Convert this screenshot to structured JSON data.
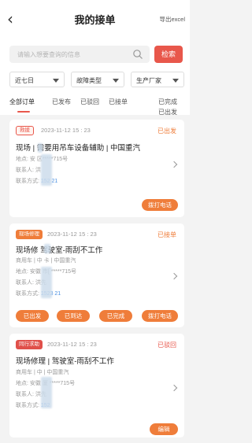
{
  "header": {
    "title": "我的接单",
    "export_label": "导出excel"
  },
  "search": {
    "placeholder": "请输入想要查询的信息",
    "button_label": "检索"
  },
  "filters": [
    {
      "label": "近七日"
    },
    {
      "label": "故障类型"
    },
    {
      "label": "生产厂家"
    }
  ],
  "tabs": [
    "全部订单",
    "已发布",
    "已驳回",
    "已接单",
    "已完成",
    "已出发"
  ],
  "cards": [
    {
      "badge": "救援",
      "time": "2023-11-12 15 : 23",
      "status": "已出发",
      "title": "现场   | 需要用吊车设备辅助 | 中国重汽",
      "lines": [
        "地点: 安        区*****715号",
        "联系人:  洪",
        "联系方式: 152          21"
      ],
      "phone": "152          21",
      "buttons": [
        "拨打电话"
      ]
    },
    {
      "badge": "现场修理",
      "time": "2023-11-12 15 : 23",
      "status": "已接单",
      "title": "现场修   驾驶室-雨刮不工作",
      "lines": [
        "商用车 | 中       卡 | 中国重汽",
        "地点: 安徽      市[       *****715号",
        "联系人:  洪先",
        "联系方式: 1523          21"
      ],
      "phone": "1523          21",
      "buttons": [
        "已出发",
        "已到达",
        "已完成",
        "拨打电话"
      ]
    },
    {
      "badge": "同行求助",
      "time": "2023-11-12 15 : 23",
      "status": "已驳回",
      "title": "现场修理 | 驾驶室-雨刮不工作",
      "lines": [
        "商用车 | 中       | 中国重汽",
        "地点: 安徽       厦      *****715号",
        "联系人:  洪先",
        "联系方式: 152           "
      ],
      "phone": "152           ",
      "buttons": [
        "编辑"
      ]
    }
  ],
  "colors": {
    "accent": "#e8574b",
    "orange": "#ef7d3a",
    "phone": "#4a90e2"
  }
}
